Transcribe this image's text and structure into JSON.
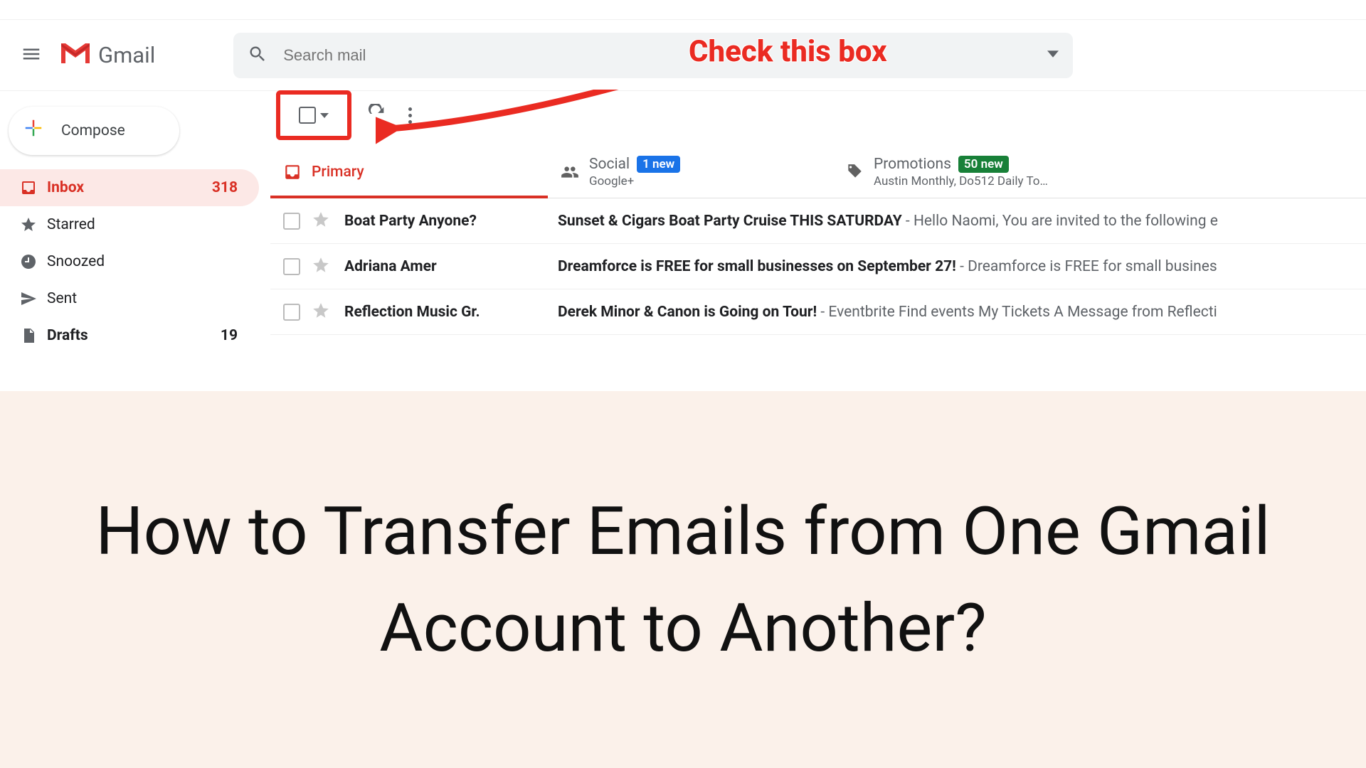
{
  "header": {
    "logo_text": "Gmail",
    "search_placeholder": "Search mail"
  },
  "annotation": {
    "callout": "Check this box"
  },
  "sidebar": {
    "compose_label": "Compose",
    "items": [
      {
        "label": "Inbox",
        "count": "318"
      },
      {
        "label": "Starred",
        "count": ""
      },
      {
        "label": "Snoozed",
        "count": ""
      },
      {
        "label": "Sent",
        "count": ""
      },
      {
        "label": "Drafts",
        "count": "19"
      }
    ]
  },
  "tabs": {
    "primary": {
      "label": "Primary"
    },
    "social": {
      "label": "Social",
      "badge": "1 new",
      "sub": "Google+"
    },
    "promotions": {
      "label": "Promotions",
      "badge": "50 new",
      "sub": "Austin Monthly, Do512 Daily To…"
    }
  },
  "mails": [
    {
      "sender": "Boat Party Anyone?",
      "subject": "Sunset & Cigars Boat Party Cruise THIS SATURDAY",
      "preview": " - Hello Naomi, You are invited to the following e"
    },
    {
      "sender": "Adriana Amer",
      "subject": "Dreamforce is FREE for small businesses on September 27!",
      "preview": " - Dreamforce is FREE for small busines"
    },
    {
      "sender": "Reflection Music Gr.",
      "subject": "Derek Minor & Canon is Going on Tour!",
      "preview": " - Eventbrite Find events My Tickets A Message from Reflecti"
    }
  ],
  "title_overlay": "How to Transfer Emails from One Gmail Account to Another?"
}
